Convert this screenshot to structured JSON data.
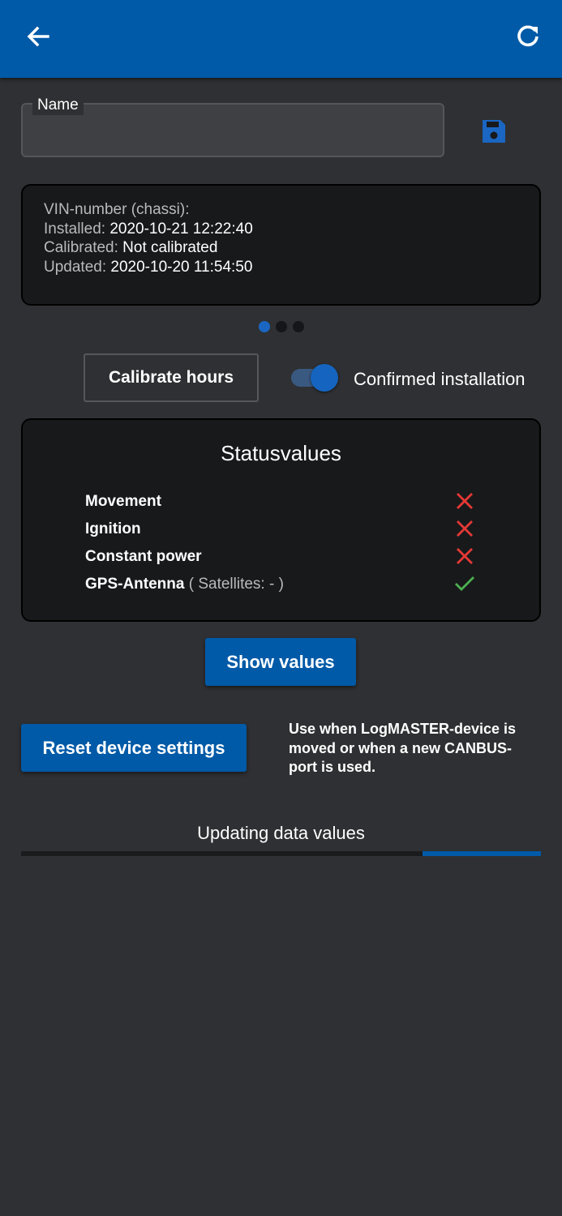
{
  "appbar": {
    "back_icon": "arrow-left-icon",
    "refresh_icon": "refresh-icon",
    "color": "#015aa7"
  },
  "name_field": {
    "label": "Name",
    "value": "",
    "save_icon": "save-floppy-icon"
  },
  "info": {
    "vin_label": "VIN-number (chassi):",
    "vin_value": "",
    "installed_label": "Installed:",
    "installed_value": "2020-10-21 12:22:40",
    "calibrated_label": "Calibrated:",
    "calibrated_value": "Not calibrated",
    "updated_label": "Updated:",
    "updated_value": "2020-10-20 11:54:50"
  },
  "pager": {
    "count": 3,
    "active": 0
  },
  "calibrate_button": "Calibrate hours",
  "confirmed_toggle": {
    "label": "Confirmed installation",
    "on": true
  },
  "status": {
    "title": "Statusvalues",
    "rows": [
      {
        "label": "Movement",
        "extra": "",
        "ok": false
      },
      {
        "label": "Ignition",
        "extra": "",
        "ok": false
      },
      {
        "label": "Constant power",
        "extra": "",
        "ok": false
      },
      {
        "label": "GPS-Antenna",
        "extra": "( Satellites: - )",
        "ok": true
      }
    ],
    "ok_color": "#4caf50",
    "fail_color": "#e53935"
  },
  "show_values_button": "Show values",
  "reset": {
    "button": "Reset device settings",
    "note": "Use when LogMASTER-device is moved or when a new CANBUS-port is used."
  },
  "updating": {
    "label": "Updating data values",
    "progress_start": 0.772,
    "progress_end": 1.0
  }
}
